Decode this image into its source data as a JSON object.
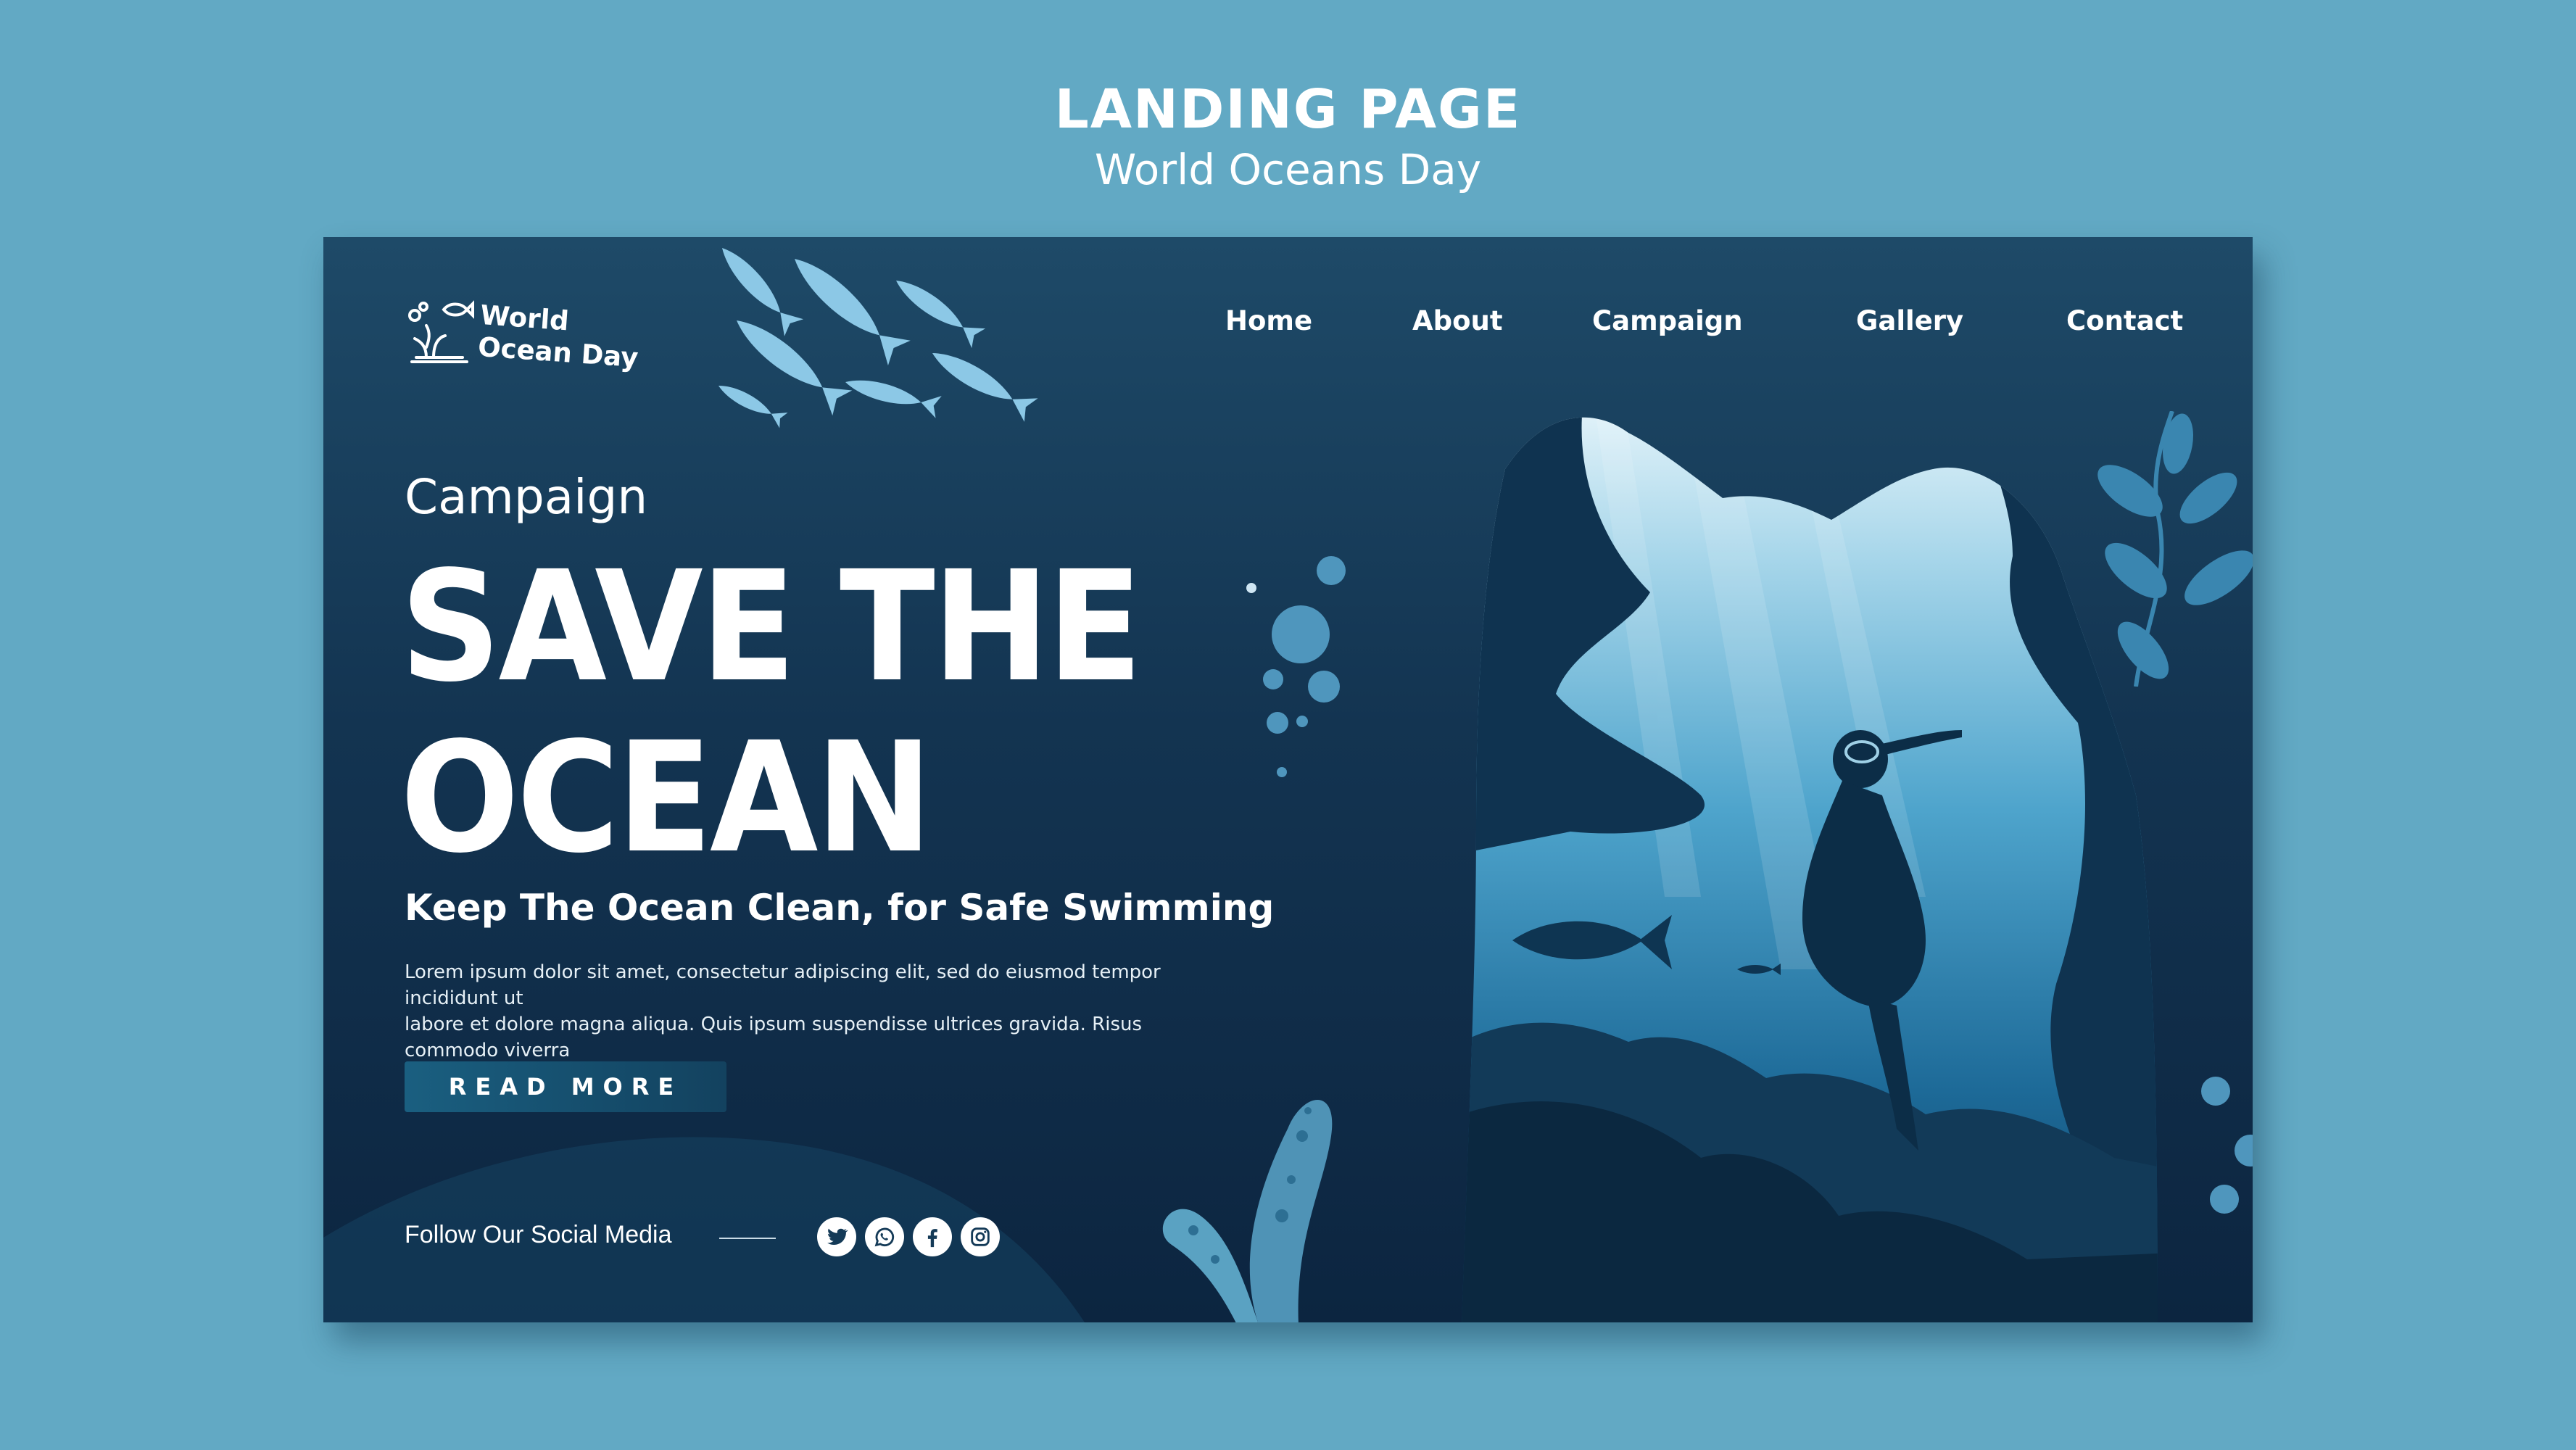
{
  "outer": {
    "title": "LANDING PAGE",
    "subtitle": "World Oceans Day"
  },
  "logo": {
    "line1": "World",
    "line2": "Ocean Day",
    "icon": "coral-fish-icon"
  },
  "nav": {
    "items": [
      {
        "label": "Home"
      },
      {
        "label": "About"
      },
      {
        "label": "Campaign"
      },
      {
        "label": "Gallery"
      },
      {
        "label": "Contact"
      }
    ]
  },
  "hero": {
    "kicker": "Campaign",
    "title_line1": "SAVE THE",
    "title_line2": "OCEAN",
    "subtitle": "Keep The Ocean Clean, for Safe Swimming",
    "body_line1": "Lorem ipsum dolor sit amet, consectetur adipiscing elit, sed do eiusmod tempor incididunt ut",
    "body_line2": "labore et dolore magna aliqua. Quis ipsum suspendisse ultrices gravida. Risus commodo viverra",
    "cta": "READ MORE"
  },
  "social": {
    "label": "Follow Our Social Media",
    "icons": [
      "twitter-icon",
      "whatsapp-icon",
      "facebook-icon",
      "instagram-icon"
    ]
  },
  "colors": {
    "page_bg": "#62a9c4",
    "panel_dark": "#0c2540",
    "panel_top": "#1e4a68",
    "accent_light": "#8cc8e6",
    "button": "#1a5f80",
    "text": "#ffffff"
  }
}
